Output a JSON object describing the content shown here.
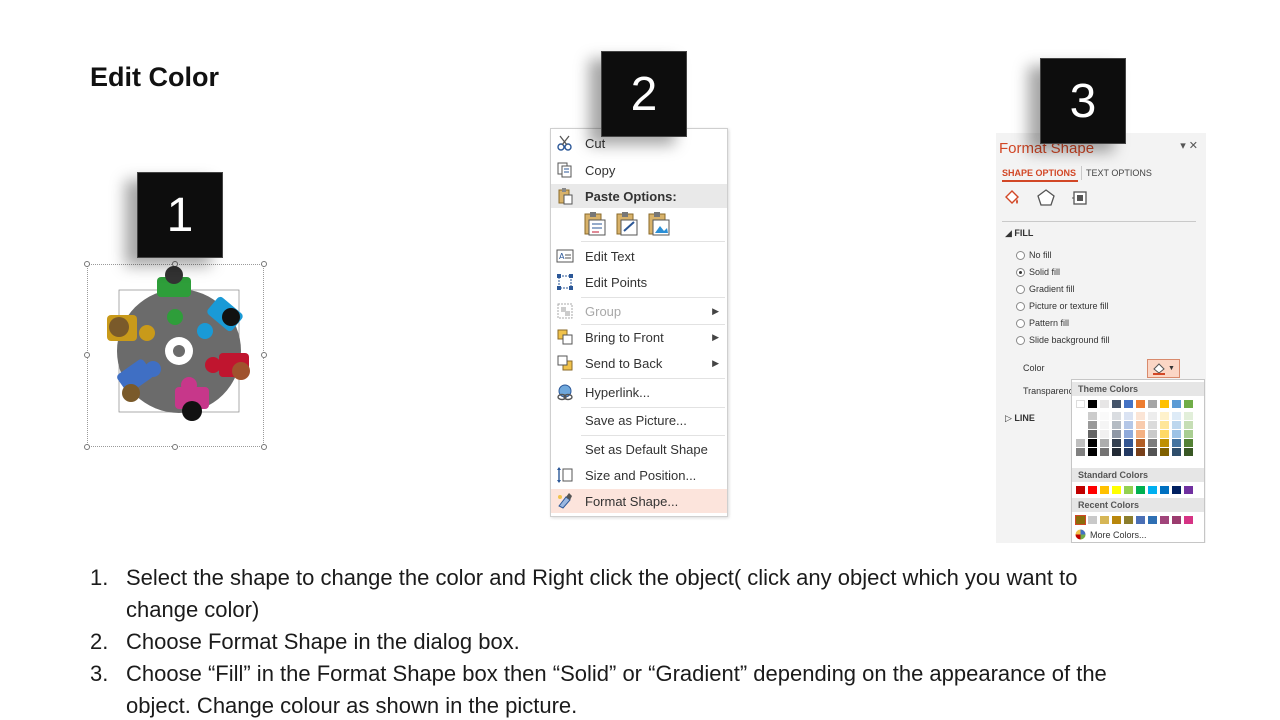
{
  "slide": {
    "title": "Edit Color"
  },
  "step_badges": [
    "1",
    "2",
    "3"
  ],
  "context_menu": {
    "items": [
      {
        "label": "Cut",
        "icon": "scissors-icon"
      },
      {
        "label": "Copy",
        "icon": "copy-icon"
      },
      {
        "label": "Paste Options:",
        "icon": "paste-icon"
      },
      {
        "label": "Edit Text",
        "icon": "edit-text-icon"
      },
      {
        "label": "Edit Points",
        "icon": "edit-points-icon"
      },
      {
        "label": "Group",
        "icon": "group-icon",
        "disabled": true
      },
      {
        "label": "Bring to Front",
        "icon": "bring-to-front-icon"
      },
      {
        "label": "Send to Back",
        "icon": "send-to-back-icon"
      },
      {
        "label": "Hyperlink...",
        "icon": "hyperlink-icon"
      },
      {
        "label": "Save as Picture...",
        "icon": ""
      },
      {
        "label": "Set as Default Shape",
        "icon": ""
      },
      {
        "label": "Size and Position...",
        "icon": "size-position-icon"
      },
      {
        "label": "Format Shape...",
        "icon": "format-shape-icon",
        "highlighted": true
      }
    ]
  },
  "format_pane": {
    "title": "Format Shape",
    "tabs": [
      "SHAPE OPTIONS",
      "TEXT OPTIONS"
    ],
    "fill_section": "FILL",
    "line_section": "LINE",
    "fill_options": [
      {
        "label": "No fill",
        "selected": false
      },
      {
        "label": "Solid fill",
        "selected": true
      },
      {
        "label": "Gradient fill",
        "selected": false
      },
      {
        "label": "Picture or texture fill",
        "selected": false
      },
      {
        "label": "Pattern fill",
        "selected": false
      },
      {
        "label": "Slide background fill",
        "selected": false
      }
    ],
    "color_label": "Color",
    "transparency_label": "Transparenc",
    "palette": {
      "theme_header": "Theme Colors",
      "standard_header": "Standard Colors",
      "recent_header": "Recent Colors",
      "more_colors": "More Colors...",
      "theme_colors": [
        "#ffffff",
        "#000000",
        "#e7e6e6",
        "#44546a",
        "#4472c4",
        "#ed7d31",
        "#a5a5a5",
        "#ffc000",
        "#5b9bd5",
        "#70ad47"
      ],
      "standard_colors": [
        "#c00000",
        "#ff0000",
        "#ffc000",
        "#ffff00",
        "#92d050",
        "#00b050",
        "#00b0f0",
        "#0070c0",
        "#002060",
        "#7030a0"
      ],
      "recent_colors": [
        "#8a6d0b",
        "#c9c9c9",
        "#d6b656",
        "#b8860b",
        "#8b7d2b",
        "#4a6fb5",
        "#2e6fb3",
        "#a0447a",
        "#9b3b6e",
        "#d63384"
      ]
    }
  },
  "instructions": [
    {
      "num": "1.",
      "text": "Select the shape to change the color and Right click the object( click any object which you want to change color)"
    },
    {
      "num": "2.",
      "text": "Choose Format Shape in the dialog box."
    },
    {
      "num": "3.",
      "text": "Choose “Fill” in the Format Shape box then “Solid” or “Gradient” depending on the appearance of the object. Change colour as shown in the picture."
    }
  ]
}
